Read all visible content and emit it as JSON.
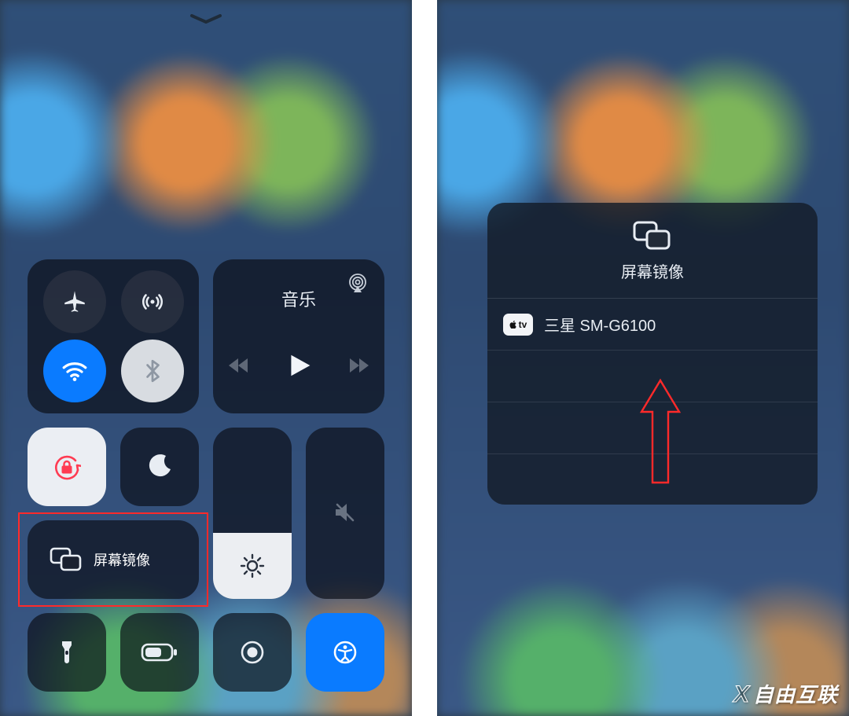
{
  "left": {
    "media_title": "音乐",
    "mirror_label": "屏幕镜像",
    "icons": {
      "airplane": "airplane-icon",
      "cellular": "cellular-antenna-icon",
      "wifi": "wifi-icon",
      "bluetooth": "bluetooth-icon",
      "airplay_audio": "airplay-audio-icon",
      "prev": "prev-icon",
      "play": "play-icon",
      "next": "next-icon",
      "orientation_lock": "orientation-lock-icon",
      "dnd": "do-not-disturb-icon",
      "screen_mirror": "screen-mirror-icon",
      "brightness": "brightness-icon",
      "mute": "mute-icon",
      "flashlight": "flashlight-icon",
      "battery": "low-power-icon",
      "screen_record": "screen-record-icon",
      "accessibility": "accessibility-icon"
    },
    "toggles": {
      "airplane_on": false,
      "cellular_on": false,
      "wifi_on": true,
      "bluetooth_on": true,
      "orientation_lock_on": true,
      "dnd_on": false,
      "mute_on": true
    },
    "sliders": {
      "brightness_pct": 38,
      "volume_pct": 0
    },
    "colors": {
      "active_blue": "#0a7bff",
      "lock_accent": "#ff3b52",
      "highlight_red": "#ff2a2a"
    }
  },
  "right": {
    "popup_title": "屏幕镜像",
    "devices": [
      {
        "name": "三星 SM-G6100",
        "badge": "tv"
      }
    ]
  },
  "watermark": "自由互联"
}
